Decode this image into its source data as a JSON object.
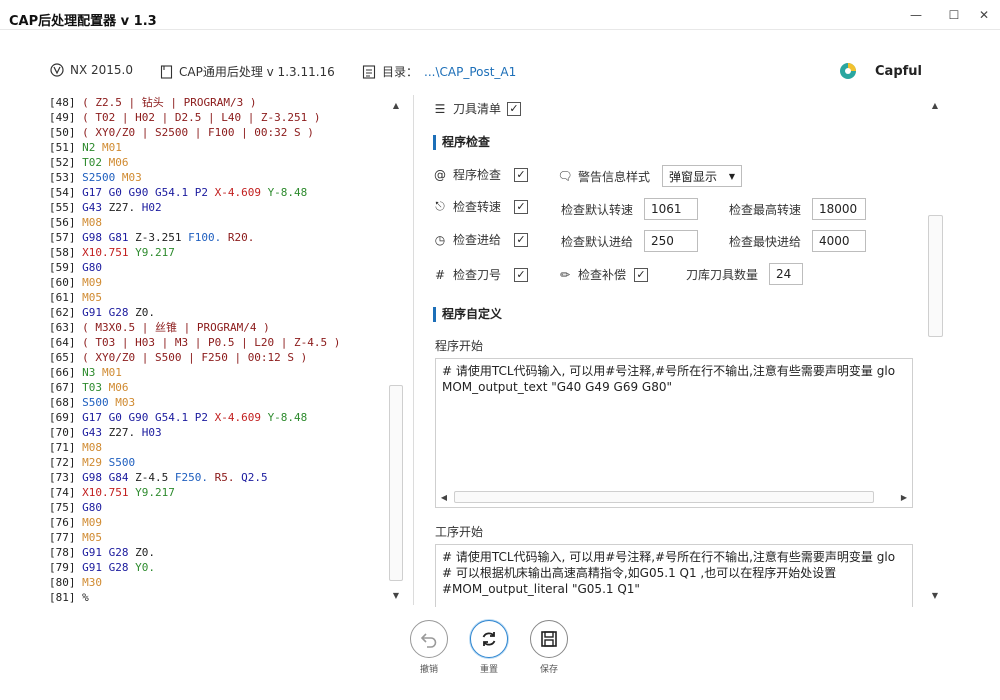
{
  "window": {
    "title": "CAP后处理配置器 v 1.3",
    "min_icon": "minimize-icon",
    "max_icon": "maximize-icon",
    "close_icon": "close-icon"
  },
  "infobar": {
    "nx": "NX 2015.0",
    "cap": "CAP通用后处理 v 1.3.11.16",
    "dir_label": "目录：",
    "dir_value": "...\\CAP_Post_A1",
    "brand": "Capful"
  },
  "code_lines": [
    [
      [
        "[48] ",
        "#222"
      ],
      [
        "( Z2.5 | 钻头 | PROGRAM/3 )",
        "#8b1a1a"
      ]
    ],
    [
      [
        "[49] ",
        "#222"
      ],
      [
        "( T02 | H02 | D2.5 | L40 | Z-3.251 )",
        "#8b1a1a"
      ]
    ],
    [
      [
        "[50] ",
        "#222"
      ],
      [
        "( XY0/Z0 | S2500 | F100 | 00:32 S )",
        "#8b1a1a"
      ]
    ],
    [
      [
        "[51] ",
        "#222"
      ],
      [
        "N2 ",
        "#2e8b2e"
      ],
      [
        "M01",
        "#d08a30"
      ]
    ],
    [
      [
        "[52] ",
        "#222"
      ],
      [
        "T02 ",
        "#2e8b2e"
      ],
      [
        "M06",
        "#d08a30"
      ]
    ],
    [
      [
        "[53] ",
        "#222"
      ],
      [
        "S2500 ",
        "#1f5fbf"
      ],
      [
        "M03",
        "#d08a30"
      ]
    ],
    [
      [
        "[54] ",
        "#222"
      ],
      [
        "G17 G0 G90 G54.1 P2 ",
        "#1b1b9e"
      ],
      [
        "X-4.609 ",
        "#c22020"
      ],
      [
        "Y-8.48",
        "#2e8b2e"
      ]
    ],
    [
      [
        "[55] ",
        "#222"
      ],
      [
        "G43 ",
        "#1b1b9e"
      ],
      [
        "Z27. ",
        "#222"
      ],
      [
        "H02",
        "#1b1b9e"
      ]
    ],
    [
      [
        "[56] ",
        "#222"
      ],
      [
        "M08",
        "#d08a30"
      ]
    ],
    [
      [
        "[57] ",
        "#222"
      ],
      [
        "G98 G81 ",
        "#1b1b9e"
      ],
      [
        "Z-3.251 ",
        "#222"
      ],
      [
        "F100. ",
        "#1f5fbf"
      ],
      [
        "R20.",
        "#8b1a1a"
      ]
    ],
    [
      [
        "[58] ",
        "#222"
      ],
      [
        "X10.751 ",
        "#c22020"
      ],
      [
        "Y9.217",
        "#2e8b2e"
      ]
    ],
    [
      [
        "[59] ",
        "#222"
      ],
      [
        "G80",
        "#1b1b9e"
      ]
    ],
    [
      [
        "[60] ",
        "#222"
      ],
      [
        "M09",
        "#d08a30"
      ]
    ],
    [
      [
        "[61] ",
        "#222"
      ],
      [
        "M05",
        "#d08a30"
      ]
    ],
    [
      [
        "[62] ",
        "#222"
      ],
      [
        "G91 G28 ",
        "#1b1b9e"
      ],
      [
        "Z0.",
        "#222"
      ]
    ],
    [
      [
        "[63] ",
        "#222"
      ],
      [
        "( M3X0.5 | 丝锥 | PROGRAM/4 )",
        "#8b1a1a"
      ]
    ],
    [
      [
        "[64] ",
        "#222"
      ],
      [
        "( T03 | H03 | M3 | P0.5 | L20 | Z-4.5 )",
        "#8b1a1a"
      ]
    ],
    [
      [
        "[65] ",
        "#222"
      ],
      [
        "( XY0/Z0 | S500 | F250 | 00:12 S )",
        "#8b1a1a"
      ]
    ],
    [
      [
        "[66] ",
        "#222"
      ],
      [
        "N3 ",
        "#2e8b2e"
      ],
      [
        "M01",
        "#d08a30"
      ]
    ],
    [
      [
        "[67] ",
        "#222"
      ],
      [
        "T03 ",
        "#2e8b2e"
      ],
      [
        "M06",
        "#d08a30"
      ]
    ],
    [
      [
        "[68] ",
        "#222"
      ],
      [
        "S500 ",
        "#1f5fbf"
      ],
      [
        "M03",
        "#d08a30"
      ]
    ],
    [
      [
        "[69] ",
        "#222"
      ],
      [
        "G17 G0 G90 G54.1 P2 ",
        "#1b1b9e"
      ],
      [
        "X-4.609 ",
        "#c22020"
      ],
      [
        "Y-8.48",
        "#2e8b2e"
      ]
    ],
    [
      [
        "[70] ",
        "#222"
      ],
      [
        "G43 ",
        "#1b1b9e"
      ],
      [
        "Z27. ",
        "#222"
      ],
      [
        "H03",
        "#1b1b9e"
      ]
    ],
    [
      [
        "[71] ",
        "#222"
      ],
      [
        "M08",
        "#d08a30"
      ]
    ],
    [
      [
        "[72] ",
        "#222"
      ],
      [
        "M29 ",
        "#d08a30"
      ],
      [
        "S500",
        "#1f5fbf"
      ]
    ],
    [
      [
        "[73] ",
        "#222"
      ],
      [
        "G98 G84 ",
        "#1b1b9e"
      ],
      [
        "Z-4.5 ",
        "#222"
      ],
      [
        "F250. ",
        "#1f5fbf"
      ],
      [
        "R5. ",
        "#8b1a1a"
      ],
      [
        "Q2.5",
        "#1b1b9e"
      ]
    ],
    [
      [
        "[74] ",
        "#222"
      ],
      [
        "X10.751 ",
        "#c22020"
      ],
      [
        "Y9.217",
        "#2e8b2e"
      ]
    ],
    [
      [
        "[75] ",
        "#222"
      ],
      [
        "G80",
        "#1b1b9e"
      ]
    ],
    [
      [
        "[76] ",
        "#222"
      ],
      [
        "M09",
        "#d08a30"
      ]
    ],
    [
      [
        "[77] ",
        "#222"
      ],
      [
        "M05",
        "#d08a30"
      ]
    ],
    [
      [
        "[78] ",
        "#222"
      ],
      [
        "G91 G28 ",
        "#1b1b9e"
      ],
      [
        "Z0.",
        "#222"
      ]
    ],
    [
      [
        "[79] ",
        "#222"
      ],
      [
        "G91 G28 ",
        "#1b1b9e"
      ],
      [
        "Y0.",
        "#2e8b2e"
      ]
    ],
    [
      [
        "[80] ",
        "#222"
      ],
      [
        "M30",
        "#d08a30"
      ]
    ],
    [
      [
        "[81] ",
        "#222"
      ],
      [
        "%",
        "#222"
      ]
    ]
  ],
  "settings": {
    "tool_list_label": "刀具清单",
    "tool_list_checked": true,
    "section_check": "程序检查",
    "program_check_label": "程序检查",
    "program_check_checked": true,
    "warning_style_label": "警告信息样式",
    "warning_style_value": "弹窗显示",
    "check_speed_label": "检查转速",
    "check_speed_checked": true,
    "default_speed_label": "检查默认转速",
    "default_speed_value": "1061",
    "max_speed_label": "检查最高转速",
    "max_speed_value": "18000",
    "check_feed_label": "检查进给",
    "check_feed_checked": true,
    "default_feed_label": "检查默认进给",
    "default_feed_value": "250",
    "max_feed_label": "检查最快进给",
    "max_feed_value": "4000",
    "check_tool_label": "检查刀号",
    "check_tool_checked": true,
    "check_comp_label": "检查补偿",
    "check_comp_checked": true,
    "tool_count_label": "刀库刀具数量",
    "tool_count_value": "24",
    "section_custom": "程序自定义",
    "program_start_label": "程序开始",
    "program_start_text": "# 请使用TCL代码输入, 可以用#号注释,#号所在行不输出,注意有些需要声明变量 glo\nMOM_output_text \"G40 G49 G69 G80\"",
    "op_start_label": "工序开始",
    "op_start_text": "# 请使用TCL代码输入, 可以用#号注释,#号所在行不输出,注意有些需要声明变量 glo\n# 可以根据机床输出高速高精指令,如G05.1 Q1 ,也可以在程序开始处设置\n#MOM_output_literal \"G05.1 Q1\""
  },
  "footer": {
    "undo": "撤销",
    "reset": "重置",
    "save": "保存"
  }
}
